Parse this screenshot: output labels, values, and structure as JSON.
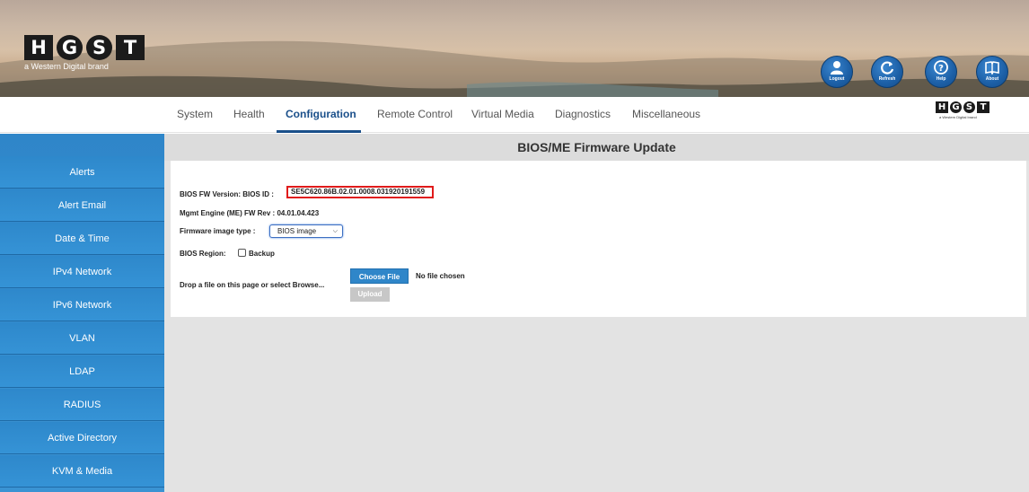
{
  "brand": {
    "letters": [
      "H",
      "G",
      "S",
      "T"
    ],
    "tagline": "a Western Digital brand"
  },
  "header_buttons": [
    {
      "label": "Logout",
      "icon": "user-icon"
    },
    {
      "label": "Refresh",
      "icon": "refresh-icon"
    },
    {
      "label": "Help",
      "icon": "help-icon"
    },
    {
      "label": "About",
      "icon": "book-icon"
    }
  ],
  "nav": {
    "items": [
      "System",
      "Health",
      "Configuration",
      "Remote Control",
      "Virtual Media",
      "Diagnostics",
      "Miscellaneous"
    ],
    "active": "Configuration"
  },
  "sidebar": {
    "items": [
      "Alerts",
      "Alert Email",
      "Date & Time",
      "IPv4 Network",
      "IPv6 Network",
      "VLAN",
      "LDAP",
      "RADIUS",
      "Active Directory",
      "KVM & Media"
    ]
  },
  "main": {
    "title": "BIOS/ME Firmware Update",
    "bios_fw_label": "BIOS FW Version:  BIOS ID :",
    "bios_id_value": "SE5C620.86B.02.01.0008.031920191559",
    "mgmt_engine": "Mgmt Engine (ME) FW Rev : 04.01.04.423",
    "firmware_type_label": "Firmware image type :",
    "firmware_type_value": "BIOS image",
    "bios_region_label": "BIOS Region:",
    "backup_label": "Backup",
    "drop_text": "Drop a file on this page or select Browse...",
    "choose_file_label": "Choose File",
    "no_file_text": "No file chosen",
    "upload_label": "Upload"
  },
  "colors": {
    "sidebar_blue": "#3593d6",
    "nav_active": "#1a4f8a",
    "highlight_box": "#e01b1b"
  }
}
